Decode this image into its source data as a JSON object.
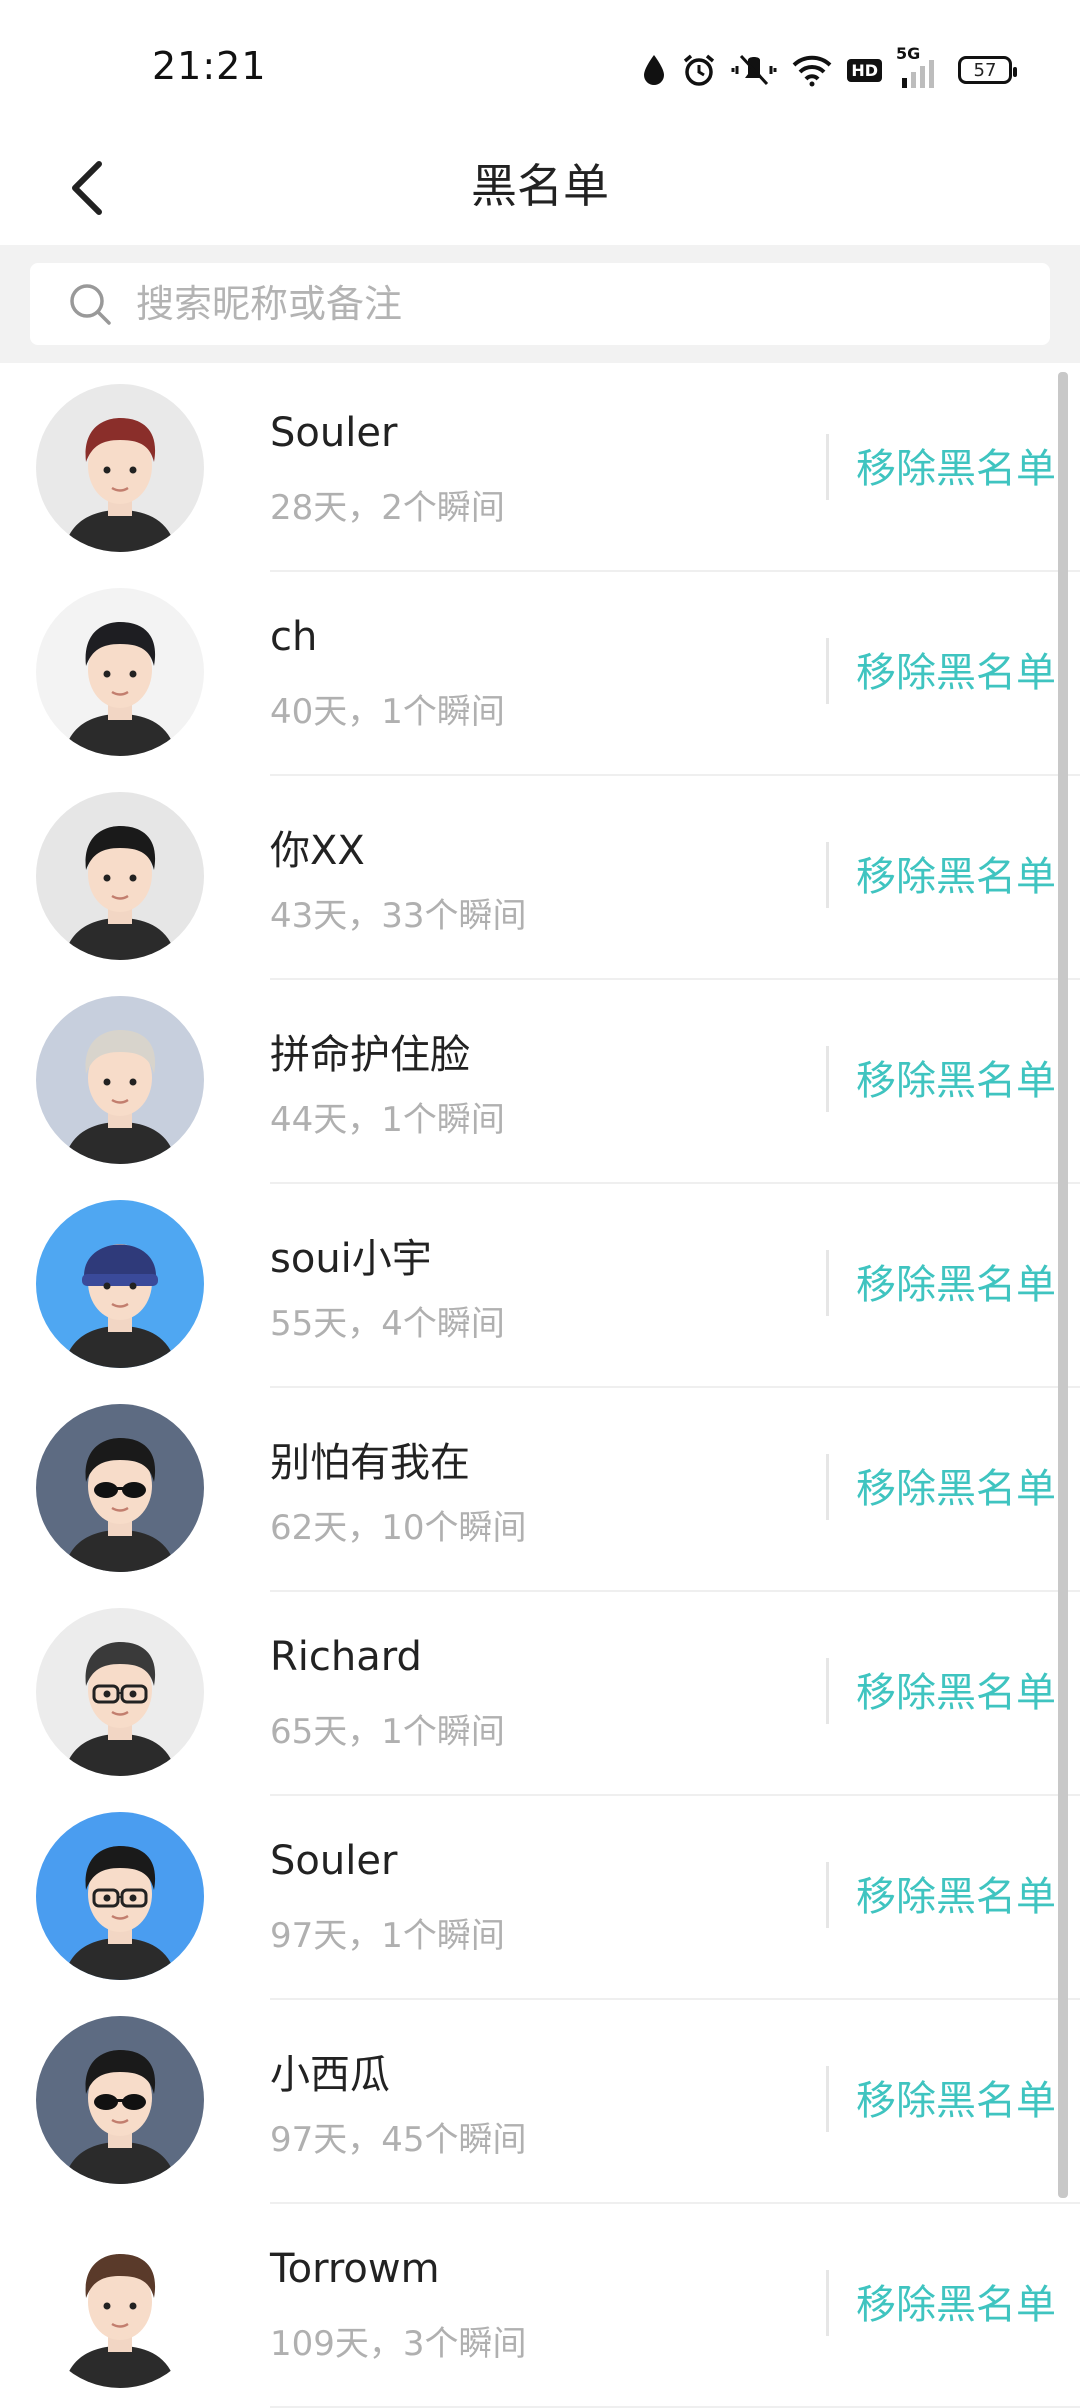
{
  "status_bar": {
    "time": "21:21",
    "network": "5G",
    "hd": "HD",
    "battery": "57",
    "icons": [
      "drop-icon",
      "alarm-icon",
      "mute-vibrate-icon",
      "wifi-icon",
      "hd-icon",
      "signal-icon",
      "battery-icon"
    ]
  },
  "header": {
    "title": "黑名单",
    "back_icon": "chevron-left-icon"
  },
  "search": {
    "placeholder": "搜索昵称或备注",
    "icon": "search-icon"
  },
  "colors": {
    "accent": "#3fc4c0",
    "muted_text": "#b0b0b0",
    "search_bg": "#f2f2f2"
  },
  "list": {
    "items": [
      {
        "name": "Souler",
        "meta": "28天，2个瞬间",
        "action": "移除黑名单",
        "avatar_bg": "#e9e9e9",
        "hair": "#8a2e2a",
        "glasses": false,
        "sunglasses": false,
        "beanie": false
      },
      {
        "name": "ch",
        "meta": "40天，1个瞬间",
        "action": "移除黑名单",
        "avatar_bg": "#f3f3f3",
        "hair": "#1e1e22",
        "glasses": false,
        "sunglasses": false,
        "beanie": false
      },
      {
        "name": "你XX",
        "meta": "43天，33个瞬间",
        "action": "移除黑名单",
        "avatar_bg": "#e6e6e6",
        "hair": "#1a1a1a",
        "glasses": false,
        "sunglasses": false,
        "beanie": false
      },
      {
        "name": "拼命护住脸",
        "meta": "44天，1个瞬间",
        "action": "移除黑名单",
        "avatar_bg": "#c7cfdd",
        "hair": "#d8d4cc",
        "glasses": false,
        "sunglasses": false,
        "beanie": false
      },
      {
        "name": "soui小宇",
        "meta": "55天，4个瞬间",
        "action": "移除黑名单",
        "avatar_bg": "#4fa7f2",
        "hair": "#2f3a7a",
        "glasses": false,
        "sunglasses": false,
        "beanie": true
      },
      {
        "name": "别怕有我在",
        "meta": "62天，10个瞬间",
        "action": "移除黑名单",
        "avatar_bg": "#5d6b82",
        "hair": "#1a1a1a",
        "glasses": false,
        "sunglasses": true,
        "beanie": false
      },
      {
        "name": "Richard",
        "meta": "65天，1个瞬间",
        "action": "移除黑名单",
        "avatar_bg": "#ececec",
        "hair": "#3a3a3a",
        "glasses": true,
        "sunglasses": false,
        "beanie": false
      },
      {
        "name": "Souler",
        "meta": "97天，1个瞬间",
        "action": "移除黑名单",
        "avatar_bg": "#4a9df0",
        "hair": "#1a1a1a",
        "glasses": true,
        "sunglasses": false,
        "beanie": false
      },
      {
        "name": "小西瓜",
        "meta": "97天，45个瞬间",
        "action": "移除黑名单",
        "avatar_bg": "#5d6b82",
        "hair": "#1a1a1a",
        "glasses": false,
        "sunglasses": true,
        "beanie": false
      },
      {
        "name": "Torrowm",
        "meta": "109天，3个瞬间",
        "action": "移除黑名单",
        "avatar_bg": "#ffffff",
        "hair": "#5a3a2a",
        "glasses": false,
        "sunglasses": false,
        "beanie": false
      }
    ]
  }
}
